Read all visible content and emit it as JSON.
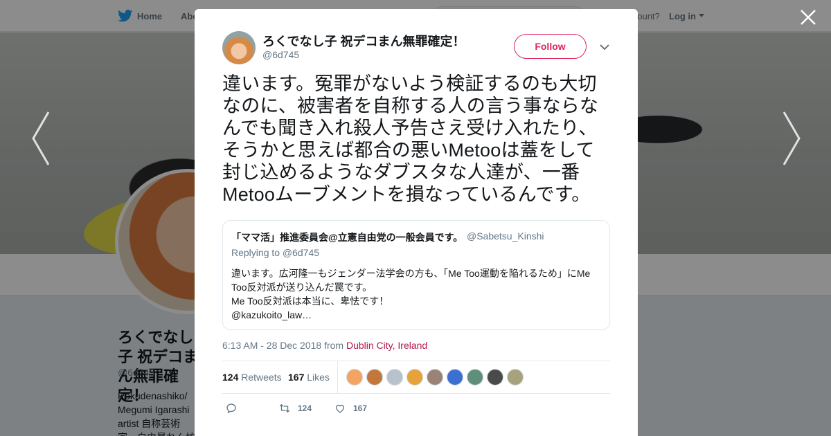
{
  "nav": {
    "home_label": "Home",
    "about_label": "Abo",
    "account_prompt": "account?",
    "login_label": "Log in"
  },
  "profile_bg": {
    "name": "ろくでなし子 祝デコまん無罪確定！",
    "handle": "@6d745",
    "bio": "Rokudenashiko/ Megumi Igarashi artist 自称芸術家。自由暴れん坊将軍逮捕起訴、デコまん"
  },
  "tweet": {
    "author_name": "ろくでなし子 祝デコまん無罪確定！",
    "author_handle": "@6d745",
    "follow_label": "Follow",
    "text": "違います。冤罪がないよう検証するのも大切なのに、被害者を自称する人の言う事ならなんでも聞き入れ殺人予告さえ受け入れたり、そうかと思えば都合の悪いMetooは蓋をして封じ込めるようなダブスタな人達が、一番Metooムーブメントを損なっているんです。",
    "timestamp": "6:13 AM - 28 Dec 2018 from",
    "location": "Dublin City, Ireland",
    "retweet_count": "124",
    "retweet_label": "Retweets",
    "like_count": "167",
    "like_label": "Likes"
  },
  "quote": {
    "name": "「ママ活」推進委員会@立憲自由党の一般会員です。",
    "handle": "@Sabetsu_Kinshi",
    "replying_to": "Replying to @6d745",
    "lines": [
      "違います。広河隆一もジェンダー法学会の方も、「Me Too運動を陥れるため」にMe",
      "Too反対派が送り込んだ罠です。",
      "Me Too反対派は本当に、卑怯です！",
      "@kazukoito_law…"
    ]
  },
  "actions": {
    "retweet_count": "124",
    "like_count": "167"
  },
  "likers": [
    {
      "icon": "liker-avatar-1",
      "color": "#f4a460"
    },
    {
      "icon": "liker-avatar-2",
      "color": "#c4773b"
    },
    {
      "icon": "liker-avatar-3",
      "color": "#b8c2cc"
    },
    {
      "icon": "liker-avatar-4",
      "color": "#e8a23a"
    },
    {
      "icon": "liker-avatar-5",
      "color": "#9b8276"
    },
    {
      "icon": "liker-avatar-6",
      "color": "#3b6fd1"
    },
    {
      "icon": "liker-avatar-7",
      "color": "#5f8f7a"
    },
    {
      "icon": "liker-avatar-8",
      "color": "#4a4a4a"
    },
    {
      "icon": "liker-avatar-9",
      "color": "#a8a27c"
    }
  ],
  "colors": {
    "accent": "#e0245e",
    "location_link": "#b0174a",
    "text_secondary": "#657786"
  }
}
